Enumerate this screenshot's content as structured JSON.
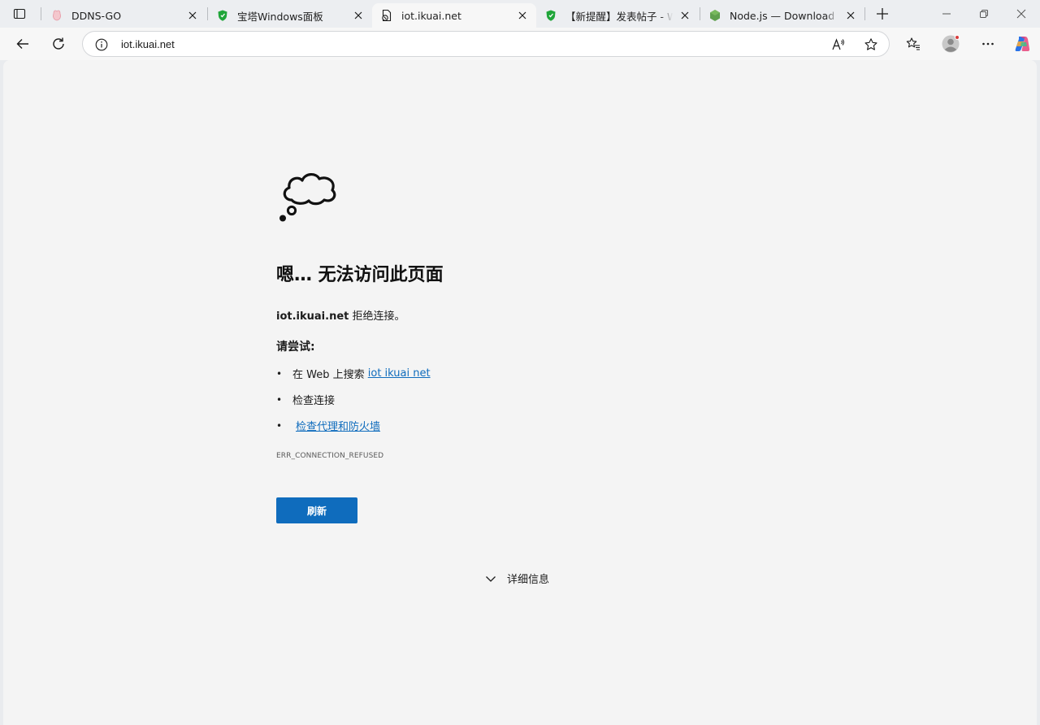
{
  "tabs": [
    {
      "title": "DDNS-GO",
      "favicon": "ddns-go-icon",
      "active": false
    },
    {
      "title": "宝塔Windows面板",
      "favicon": "bt-shield-icon",
      "active": false
    },
    {
      "title": "iot.ikuai.net",
      "favicon": "broken-page-icon",
      "active": true
    },
    {
      "title": "【新提醒】发表帖子 - Windows",
      "favicon": "bt-shield-icon",
      "active": false
    },
    {
      "title": "Node.js — Download Node.js",
      "favicon": "nodejs-icon",
      "active": false
    }
  ],
  "address_bar": {
    "url": "iot.ikuai.net"
  },
  "error_page": {
    "title": "嗯… 无法访问此页面",
    "host": "iot.ikuai.net",
    "message_suffix": " 拒绝连接。",
    "try_label": "请尝试:",
    "suggestions": {
      "search_prefix": "在 Web 上搜索 ",
      "search_link": "iot ikuai net",
      "check_connection": "检查连接",
      "proxy_firewall": "检查代理和防火墙"
    },
    "bullet": "•",
    "error_code": "ERR_CONNECTION_REFUSED",
    "refresh_label": "刷新",
    "details_label": "详细信息"
  },
  "colors": {
    "accent": "#0f6cbd",
    "page_bg": "#f4f4f4",
    "tabstrip_bg": "#eceef1"
  }
}
